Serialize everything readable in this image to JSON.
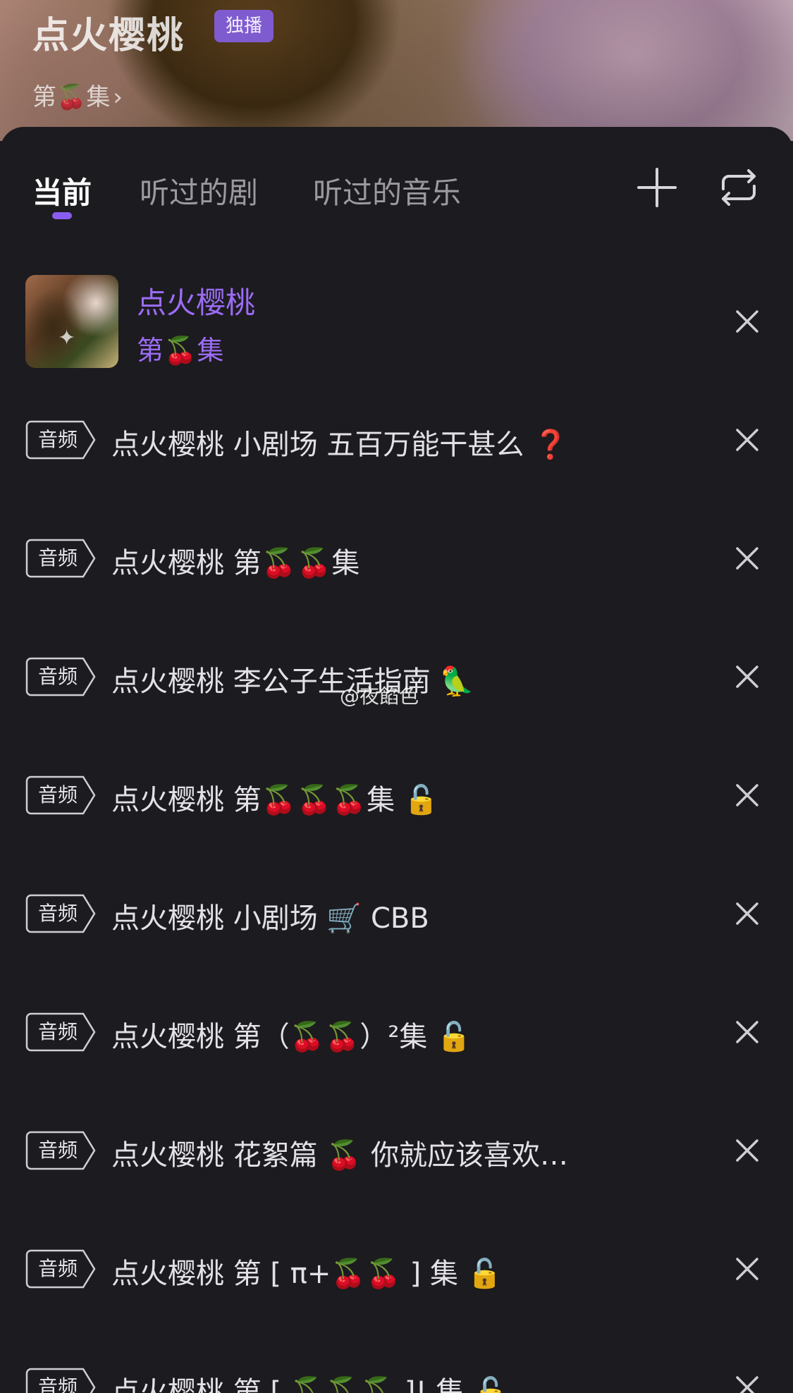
{
  "header": {
    "title": "点火樱桃",
    "badge": "独播",
    "episode_label": "第🍒集",
    "episode_chevron": "›"
  },
  "tabs": [
    {
      "label": "当前",
      "active": true
    },
    {
      "label": "听过的剧",
      "active": false
    },
    {
      "label": "听过的音乐",
      "active": false
    }
  ],
  "icons": {
    "add": "plus-icon",
    "loop": "repeat-icon",
    "close": "close-icon"
  },
  "now_playing": {
    "title": "点火樱桃",
    "episode": "第🍒集",
    "color": "#9b6cf5"
  },
  "playlist": [
    {
      "tag": "音频",
      "title": "点火樱桃 小剧场  五百万能干甚么 ❓"
    },
    {
      "tag": "音频",
      "title": "点火樱桃 第🍒🍒集"
    },
    {
      "tag": "音频",
      "title": "点火樱桃 李公子生活指南  🦜"
    },
    {
      "tag": "音频",
      "title": "点火樱桃 第🍒🍒🍒集 🔓"
    },
    {
      "tag": "音频",
      "title": "点火樱桃 小剧场 🛒 CBB"
    },
    {
      "tag": "音频",
      "title": "点火樱桃 第（🍒🍒）²集 🔓"
    },
    {
      "tag": "音频",
      "title": "点火樱桃 花絮篇 🍒 你就应该喜欢…"
    },
    {
      "tag": "音频",
      "title": "点火樱桃 第 [ π+🍒🍒 ] 集 🔓"
    },
    {
      "tag": "音频",
      "title": "点火樱桃 第 [ 🍒🍒🍒 ]! 集 🔓"
    }
  ],
  "watermark": "@夜餡色",
  "colors": {
    "accent": "#8a5df0",
    "background": "#1c1b1f",
    "badge": "#7f5bd0"
  }
}
